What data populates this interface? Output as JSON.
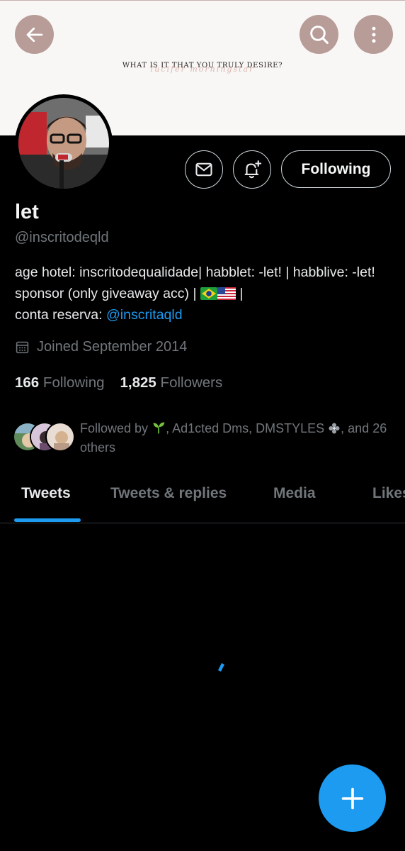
{
  "banner": {
    "tagline": "WHAT IS IT THAT YOU TRULY DESIRE?",
    "script": "lucifer morningstar"
  },
  "header": {
    "back_icon": "arrow-left-icon",
    "search_icon": "search-icon",
    "more_icon": "more-vertical-icon"
  },
  "profile": {
    "name": "let",
    "handle": "@inscritodeqld",
    "bio_part1": "age hotel: inscritodequalidade| habblet: -let! | habblive: -let! sponsor (only giveaway acc) |",
    "bio_part2": "|",
    "bio_part3": "conta reserva:",
    "bio_link": "@inscritaqld",
    "joined": "Joined September 2014",
    "following_count": "166",
    "following_label": "Following",
    "followers_count": "1,825",
    "followers_label": "Followers"
  },
  "actions": {
    "message_icon": "mail-icon",
    "notify_icon": "bell-plus-icon",
    "follow_label": "Following"
  },
  "followed_by": {
    "prefix": "Followed by",
    "names": "Ad1cted Dms, DMSTYLES",
    "suffix": ", and 26 others"
  },
  "tabs": [
    "Tweets",
    "Tweets & replies",
    "Media",
    "Likes"
  ],
  "active_tab": "Tweets",
  "colors": {
    "accent": "#1d9bf0",
    "banner_button": "#b89c98",
    "background": "#000000"
  },
  "fab": {
    "icon": "plus-icon"
  }
}
